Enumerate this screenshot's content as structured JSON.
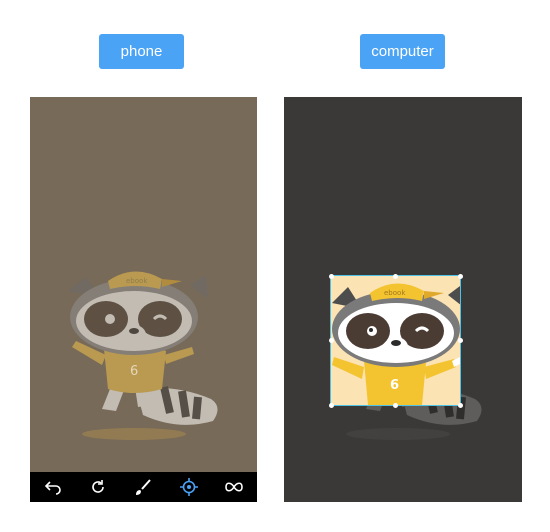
{
  "labels": {
    "phone": "phone",
    "computer": "computer"
  },
  "raccoon": {
    "cap_text": "ebook",
    "shirt_number": "6"
  },
  "toolbar": {
    "tools": [
      {
        "icon": "undo-icon"
      },
      {
        "icon": "redo-icon"
      },
      {
        "icon": "brush-icon"
      },
      {
        "icon": "target-icon",
        "active": true
      },
      {
        "icon": "infinity-icon"
      }
    ]
  },
  "colors": {
    "label_bg": "#4aa3f4",
    "phone_bg": "#786a58",
    "computer_bg": "#3a3937",
    "crop_bg": "#fbe3b3",
    "active_tool": "#4aa3f4"
  }
}
